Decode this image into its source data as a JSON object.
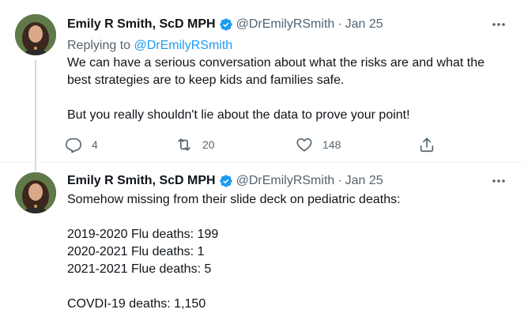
{
  "colors": {
    "accent": "#1d9bf0",
    "text_primary": "#0f1419",
    "text_secondary": "#536471",
    "thread_line": "#cfd9de"
  },
  "tweets": [
    {
      "author_name": "Emily R Smith, ScD MPH",
      "verified_icon": "verified-badge-icon",
      "handle": "@DrEmilyRSmith",
      "separator": "·",
      "date": "Jan 25",
      "replying_prefix": "Replying to ",
      "replying_to": "@DrEmilyRSmith",
      "lines": [
        "We can have a serious conversation about what the risks are and what the",
        "best strategies are to keep kids and families safe.",
        "But you really shouldn't lie about the data to prove your point!"
      ],
      "actions": {
        "reply_icon": "reply-icon",
        "reply_count": "4",
        "retweet_icon": "retweet-icon",
        "retweet_count": "20",
        "like_icon": "heart-icon",
        "like_count": "148",
        "share_icon": "share-icon"
      }
    },
    {
      "author_name": "Emily R Smith, ScD MPH",
      "verified_icon": "verified-badge-icon",
      "handle": "@DrEmilyRSmith",
      "separator": "·",
      "date": "Jan 25",
      "lines": [
        "Somehow missing from their slide deck on pediatric deaths:",
        "2019-2020 Flu deaths: 199",
        "2020-2021 Flu deaths: 1",
        "2021-2021 Flue deaths: 5",
        "COVDI-19 deaths: 1,150"
      ]
    }
  ]
}
